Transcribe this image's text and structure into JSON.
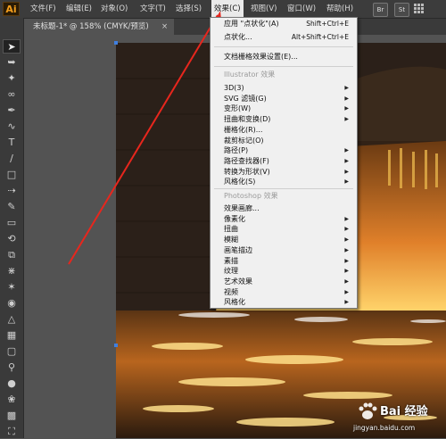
{
  "app": {
    "logo": "Ai"
  },
  "menubar": {
    "items": [
      "文件(F)",
      "编辑(E)",
      "对象(O)",
      "文字(T)",
      "选择(S)",
      "效果(C)",
      "视图(V)",
      "窗口(W)",
      "帮助(H)"
    ],
    "app_buttons": [
      "Br",
      "St"
    ]
  },
  "document": {
    "tab_title": "未标题-1* @ 158% (CMYK/预览)",
    "close_glyph": "×"
  },
  "effect_menu": {
    "top_items": [
      {
        "label": "应用 \"点状化\"(A)",
        "shortcut": "Shift+Ctrl+E"
      },
      {
        "label": "点状化...",
        "shortcut": "Alt+Shift+Ctrl+E"
      }
    ],
    "doc_raster_settings": "文档栅格效果设置(E)...",
    "illustrator_header": "Illustrator 效果",
    "illustrator_items": [
      {
        "label": "3D(3)",
        "submenu": true
      },
      {
        "label": "SVG 滤镜(G)",
        "submenu": true
      },
      {
        "label": "变形(W)",
        "submenu": true
      },
      {
        "label": "扭曲和变换(D)",
        "submenu": true
      },
      {
        "label": "栅格化(R)...",
        "submenu": false
      },
      {
        "label": "裁剪标记(O)",
        "submenu": false
      },
      {
        "label": "路径(P)",
        "submenu": true
      },
      {
        "label": "路径查找器(F)",
        "submenu": true
      },
      {
        "label": "转换为形状(V)",
        "submenu": true
      },
      {
        "label": "风格化(S)",
        "submenu": true
      }
    ],
    "photoshop_header": "Photoshop 效果",
    "photoshop_items": [
      {
        "label": "效果画廊...",
        "submenu": false
      },
      {
        "label": "像素化",
        "submenu": true
      },
      {
        "label": "扭曲",
        "submenu": true
      },
      {
        "label": "模糊",
        "submenu": true
      },
      {
        "label": "画笔描边",
        "submenu": true
      },
      {
        "label": "素描",
        "submenu": true
      },
      {
        "label": "纹理",
        "submenu": true
      },
      {
        "label": "艺术效果",
        "submenu": true
      },
      {
        "label": "视频",
        "submenu": true
      },
      {
        "label": "风格化",
        "submenu": true
      }
    ]
  },
  "watermark": {
    "brand": "Bai 经验",
    "url": "jingyan.baidu.com"
  },
  "colors": {
    "menu_highlight": "#eaeaea",
    "annotation_arrow": "#e8261d",
    "app_accent": "#f29d1d"
  }
}
